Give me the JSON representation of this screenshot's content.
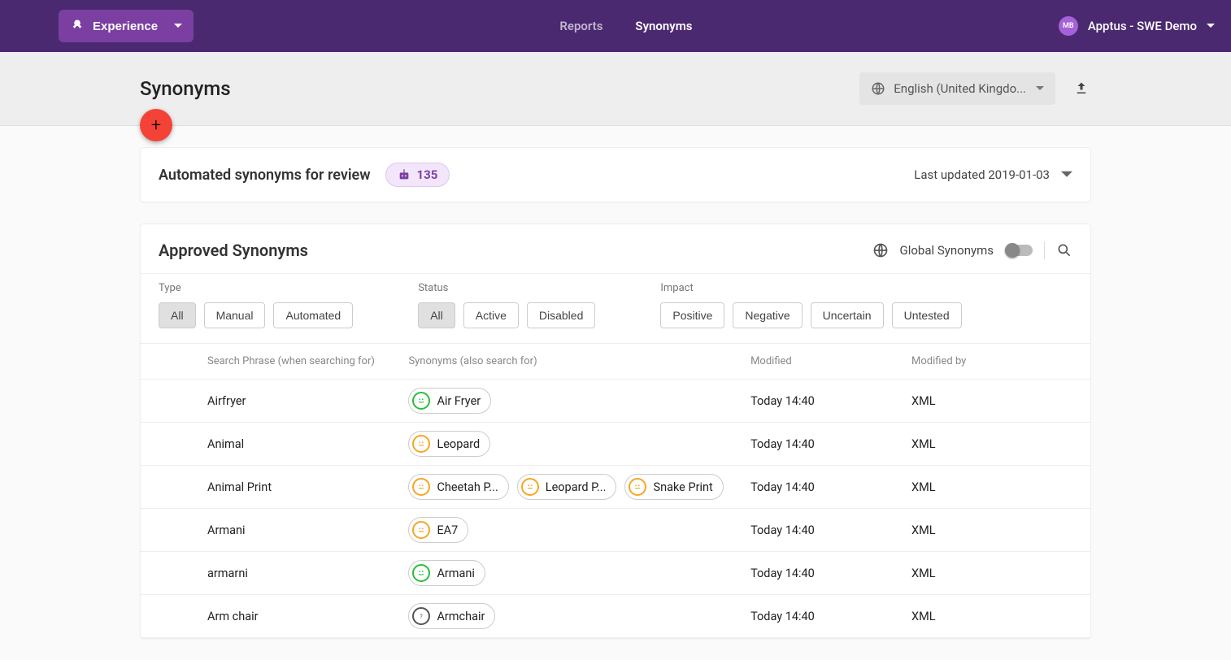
{
  "topbar": {
    "brand": "Experience",
    "nav": {
      "reports": "Reports",
      "synonyms": "Synonyms"
    },
    "user": {
      "initials": "MB",
      "label": "Apptus - SWE Demo"
    }
  },
  "page": {
    "title": "Synonyms",
    "language": "English (United Kingdo..."
  },
  "review": {
    "title": "Automated synonyms for review",
    "count": "135",
    "updated": "Last updated 2019-01-03"
  },
  "approved": {
    "title": "Approved Synonyms",
    "global_label": "Global Synonyms"
  },
  "filters": {
    "type": {
      "label": "Type",
      "options": [
        "All",
        "Manual",
        "Automated"
      ]
    },
    "status": {
      "label": "Status",
      "options": [
        "All",
        "Active",
        "Disabled"
      ]
    },
    "impact": {
      "label": "Impact",
      "options": [
        "Positive",
        "Negative",
        "Uncertain",
        "Untested"
      ]
    }
  },
  "columns": {
    "phrase": "Search Phrase (when searching for)",
    "synonyms": "Synonyms (also search for)",
    "modified": "Modified",
    "by": "Modified by"
  },
  "rows": [
    {
      "phrase": "Airfryer",
      "syn": [
        {
          "t": "Air Fryer",
          "m": "pos"
        }
      ],
      "mod": "Today 14:40",
      "by": "XML"
    },
    {
      "phrase": "Animal",
      "syn": [
        {
          "t": "Leopard",
          "m": "neu"
        }
      ],
      "mod": "Today 14:40",
      "by": "XML"
    },
    {
      "phrase": "Animal Print",
      "syn": [
        {
          "t": "Cheetah P...",
          "m": "neu"
        },
        {
          "t": "Leopard P...",
          "m": "neu"
        },
        {
          "t": "Snake Print",
          "m": "neu"
        }
      ],
      "mod": "Today 14:40",
      "by": "XML"
    },
    {
      "phrase": "Armani",
      "syn": [
        {
          "t": "EA7",
          "m": "neu"
        }
      ],
      "mod": "Today 14:40",
      "by": "XML"
    },
    {
      "phrase": "armarni",
      "syn": [
        {
          "t": "Armani",
          "m": "pos"
        }
      ],
      "mod": "Today 14:40",
      "by": "XML"
    },
    {
      "phrase": "Arm chair",
      "syn": [
        {
          "t": "Armchair",
          "m": "unk"
        }
      ],
      "mod": "Today 14:40",
      "by": "XML"
    }
  ]
}
